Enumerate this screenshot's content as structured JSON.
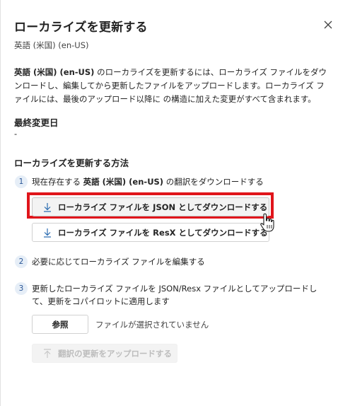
{
  "panel": {
    "title": "ローカライズを更新する",
    "subtitle": "英語 (米国) (en-US)",
    "description": {
      "bold_lang": "英語 (米国) (en-US)",
      "text": " のローカライズを更新するには、ローカライズ ファイルをダウンロードし、編集してから更新したファイルをアップロードします。ローカライズ ファイルには、最後のアップロード以降に の構造に加えた変更がすべて含まれます。"
    },
    "last_modified": {
      "heading": "最終変更日",
      "value": "-"
    },
    "how_to": {
      "heading": "ローカライズを更新する方法"
    },
    "steps": [
      {
        "number": "1",
        "text_before": "現在存在する ",
        "text_bold": "英語 (米国) (en-US)",
        "text_after": " の翻訳をダウンロードする",
        "buttons": [
          {
            "label": "ローカライズ ファイルを JSON としてダウンロードする",
            "icon": "download-icon"
          },
          {
            "label": "ローカライズ ファイルを ResX としてダウンロードする",
            "icon": "download-icon"
          }
        ]
      },
      {
        "number": "2",
        "text": "必要に応じてローカライズ ファイルを編集する"
      },
      {
        "number": "3",
        "text": "更新したローカライズ ファイルを JSON/Resx ファイルとしてアップロードして、更新をコパイロットに適用します",
        "browse_label": "参照",
        "no_file_text": "ファイルが選択されていません",
        "upload_label": "翻訳の更新をアップロードする",
        "upload_icon": "upload-icon"
      }
    ],
    "colors": {
      "highlight": "#e0151b",
      "step_badge_bg": "#e6eef7",
      "step_badge_text": "#2b5797"
    }
  }
}
